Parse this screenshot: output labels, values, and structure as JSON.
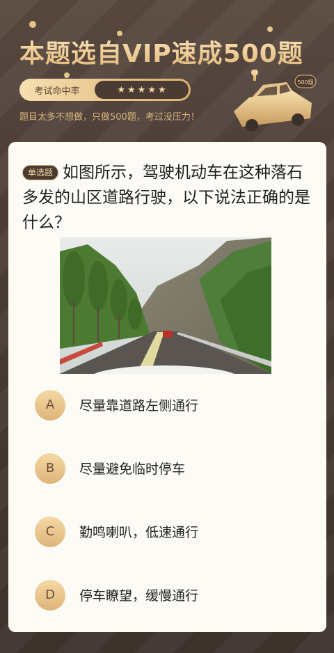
{
  "header": {
    "title": "本题选自VIP速成500题",
    "rate_label": "考试命中率",
    "stars": 5,
    "subtitle": "题目太多不想做，只做500题，考过没压力！",
    "car_badge": "500题"
  },
  "question": {
    "tag": "单选题",
    "text": "如图所示，驾驶机动车在这种落石多发的山区道路行驶，以下说法正确的是什么？",
    "image_icon": "mountain-road-photo"
  },
  "options": [
    {
      "letter": "A",
      "text": "尽量靠道路左侧通行"
    },
    {
      "letter": "B",
      "text": "尽量避免临时停车"
    },
    {
      "letter": "C",
      "text": "勤鸣喇叭，低速通行"
    },
    {
      "letter": "D",
      "text": "停车瞭望，缓慢通行"
    }
  ],
  "colors": {
    "accent_gold": "#e3b878",
    "dark_brown": "#4a3d36",
    "card_bg": "#fdfbf6"
  }
}
